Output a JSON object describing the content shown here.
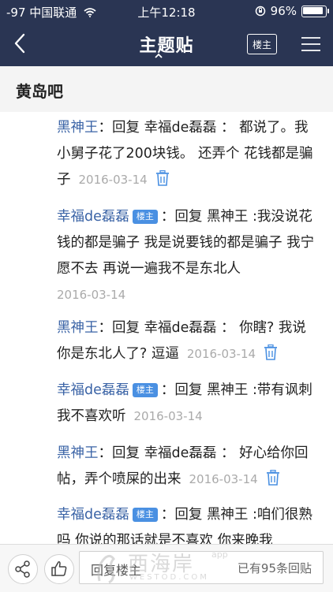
{
  "status_bar": {
    "carrier": "-97 中国联通",
    "time": "上午12:18",
    "battery": "96%",
    "battery_level": 0.96
  },
  "nav": {
    "title": "主题贴",
    "op_button": "楼主"
  },
  "forum": {
    "name": "黄岛吧"
  },
  "replies": [
    {
      "user": "黑神王",
      "is_op": false,
      "text": "：回复 幸福de磊磊 ： 都说了。我小舅子花了200块钱。 还弄个 花钱都是骗子",
      "date": "2016-03-14",
      "deletable": true
    },
    {
      "user": "幸福de磊磊",
      "is_op": true,
      "badge": "楼主",
      "text": "：回复 黑神王 :我没说花钱的都是骗子 我是说要钱的都是骗子 我宁愿不去 再说一遍我不是东北人",
      "date": "2016-03-14",
      "deletable": false
    },
    {
      "user": "黑神王",
      "is_op": false,
      "text": "：回复 幸福de磊磊 ： 你瞎? 我说你是东北人了? 逗逼",
      "date": "2016-03-14",
      "deletable": true
    },
    {
      "user": "幸福de磊磊",
      "is_op": true,
      "badge": "楼主",
      "text": "：回复 黑神王 :带有讽刺 我不喜欢听",
      "date": "2016-03-14",
      "deletable": false
    },
    {
      "user": "黑神王",
      "is_op": false,
      "text": "：回复 幸福de磊磊 ： 好心给你回帖，弄个喷屎的出来",
      "date": "2016-03-14",
      "deletable": true
    },
    {
      "user": "幸福de磊磊",
      "is_op": true,
      "badge": "楼主",
      "text": "：回复 黑神王 :咱们很熟吗 你说的那话就是不喜欢 你来晚我",
      "date": "",
      "deletable": false
    }
  ],
  "bottom_bar": {
    "reply_placeholder": "回复楼主",
    "reply_count": "已有95条回贴"
  },
  "watermark": {
    "main": "西海岸",
    "app": "app",
    "sub": "WESTOD.COM"
  }
}
